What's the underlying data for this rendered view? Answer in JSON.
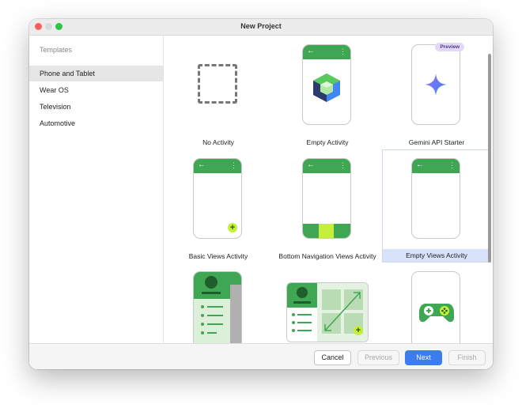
{
  "window": {
    "title": "New Project"
  },
  "sidebar": {
    "header": "Templates",
    "items": [
      {
        "label": "Phone and Tablet",
        "selected": true
      },
      {
        "label": "Wear OS",
        "selected": false
      },
      {
        "label": "Television",
        "selected": false
      },
      {
        "label": "Automotive",
        "selected": false
      }
    ]
  },
  "templates": [
    {
      "label": "No Activity"
    },
    {
      "label": "Empty Activity"
    },
    {
      "label": "Gemini API Starter",
      "badge": "Preview"
    },
    {
      "label": "Basic Views Activity"
    },
    {
      "label": "Bottom Navigation Views Activity"
    },
    {
      "label": "Empty Views Activity",
      "selected": true
    },
    {
      "label": ""
    },
    {
      "label": ""
    },
    {
      "label": ""
    }
  ],
  "footer": {
    "cancel": "Cancel",
    "previous": "Previous",
    "next": "Next",
    "finish": "Finish"
  },
  "colors": {
    "accent": "#3b7df0",
    "android_green": "#3fa653",
    "fab_lime": "#c5ef3a",
    "selection": "#d8e3fb"
  }
}
